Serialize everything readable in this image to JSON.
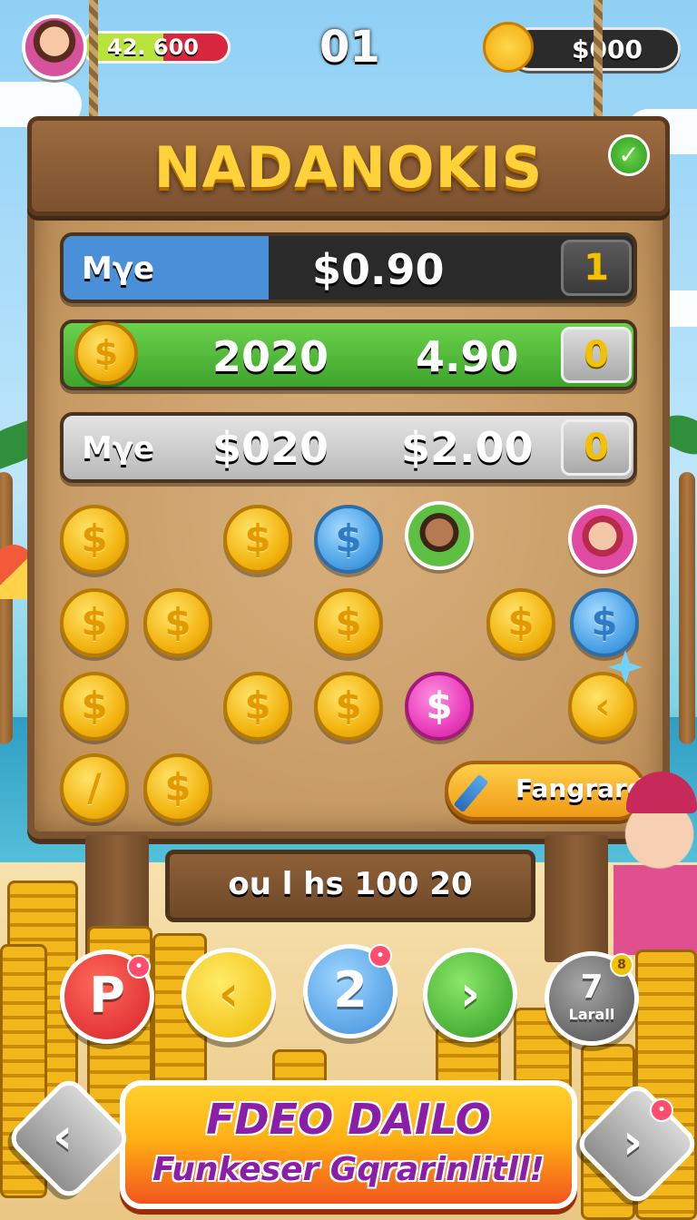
{
  "hud": {
    "xp_text": "42. 600",
    "level": "01",
    "currency": "$000"
  },
  "board": {
    "title": "NADANOKIS",
    "rows": [
      {
        "label": "Mγe",
        "value1": "$0.90",
        "value2": "",
        "badge": "1"
      },
      {
        "label": "",
        "value1": "2020",
        "value2": "4.90",
        "badge": "0"
      },
      {
        "label": "Mγe",
        "value1": "$020",
        "value2": "$2.00",
        "badge": "0"
      }
    ],
    "coin_symbol": "$",
    "fangrards_label": "Fangrards"
  },
  "plank_text": "ou l hs 100 20",
  "buttons": {
    "red_label": "P",
    "yellow_label": "‹",
    "blue_label": "2",
    "green_label": "›",
    "gray_number": "7",
    "gray_badge": "8",
    "gray_label": "Larall"
  },
  "banner": {
    "line1": "FDEO DAILO",
    "line2": "Funkeser Gqrarinlitll!"
  },
  "colors": {
    "accent_gold": "#ffd23a",
    "banner_text": "#8a1fa7",
    "green_row": "#4fbf3a",
    "blue_row": "#4a90d9"
  }
}
